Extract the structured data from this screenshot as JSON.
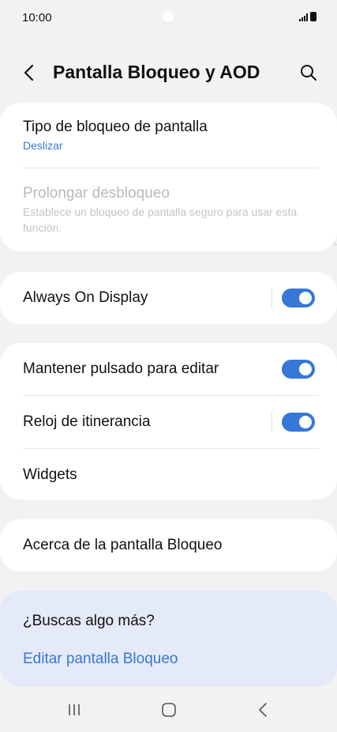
{
  "status": {
    "time": "10:00"
  },
  "header": {
    "title": "Pantalla Bloqueo y AOD",
    "back_icon": "chevron-left-icon",
    "search_icon": "search-icon"
  },
  "lock": {
    "type_label": "Tipo de bloqueo de pantalla",
    "type_value": "Deslizar",
    "extend_label": "Prolongar desbloqueo",
    "extend_desc": "Establece un bloqueo de pantalla seguro para usar esta función."
  },
  "aod": {
    "label": "Always On Display",
    "enabled": true
  },
  "options": {
    "hold_label": "Mantener pulsado para editar",
    "hold_enabled": true,
    "roaming_label": "Reloj de itinerancia",
    "roaming_enabled": true,
    "widgets_label": "Widgets"
  },
  "about": {
    "label": "Acerca de la pantalla Bloqueo"
  },
  "more": {
    "question": "¿Buscas algo más?",
    "link1": "Editar pantalla Bloqueo"
  },
  "colors": {
    "accent": "#3777d5",
    "background": "#f2f2f4",
    "card": "#ffffff",
    "suggest_bg": "#e4eaf7"
  }
}
